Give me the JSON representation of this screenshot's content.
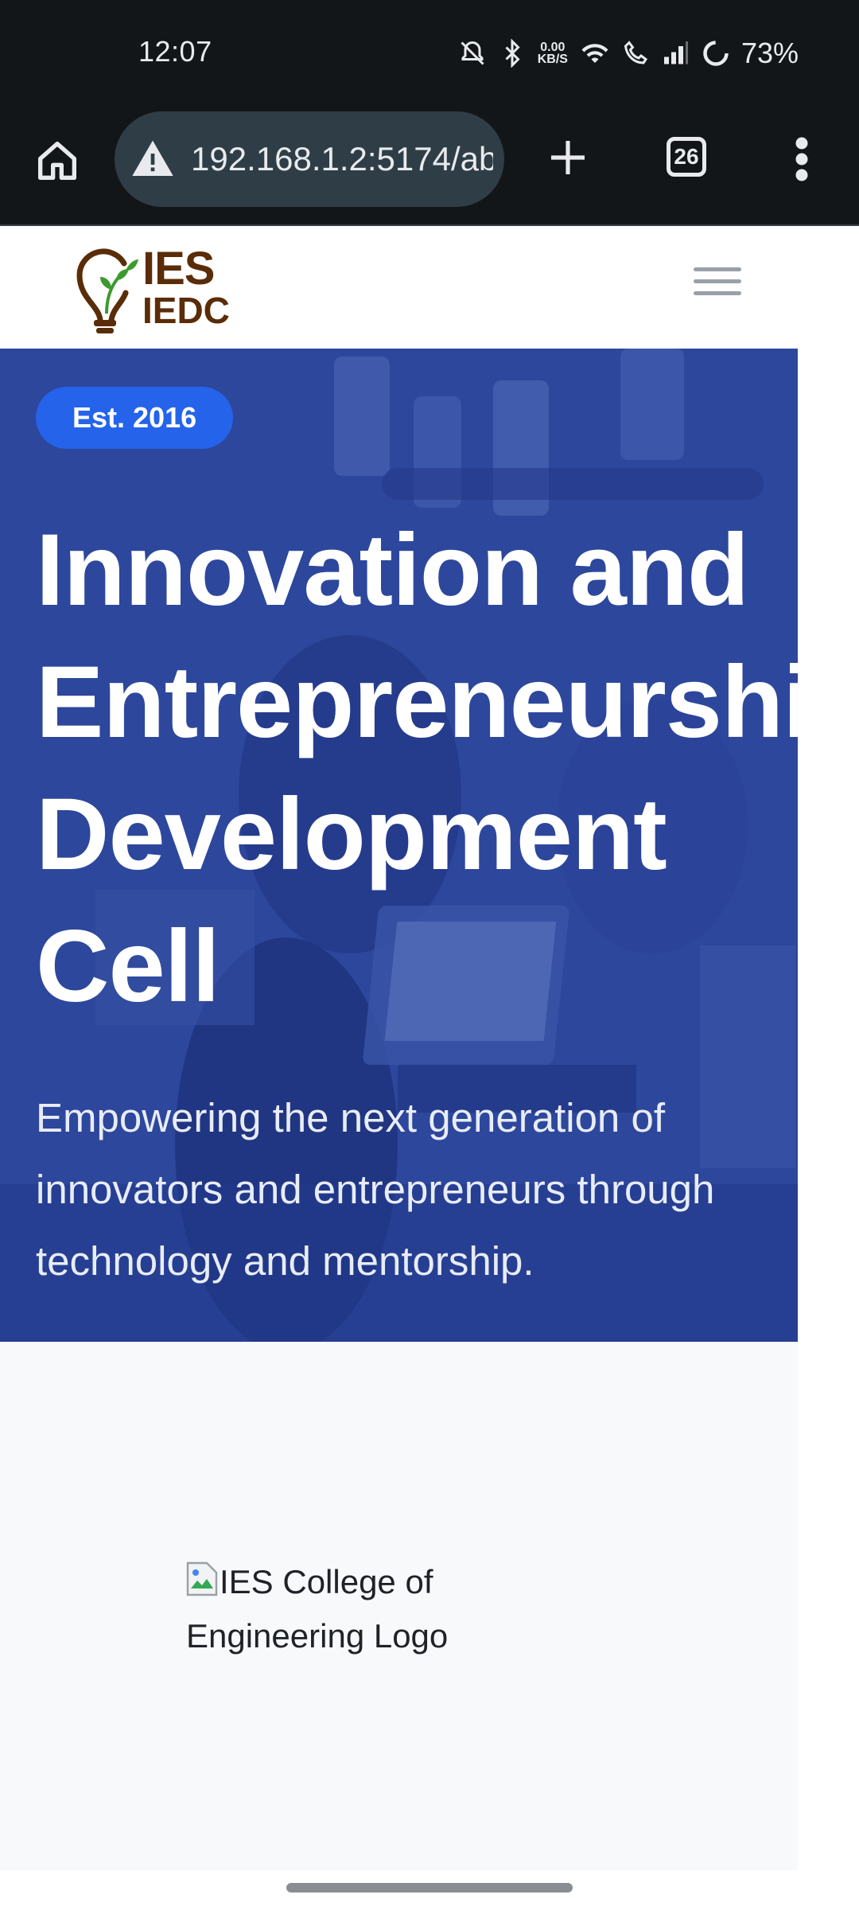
{
  "status_bar": {
    "time": "12:07",
    "net_speed_value": "0.00",
    "net_speed_unit": "KB/S",
    "battery": "73%",
    "icons": [
      "mute-icon",
      "bluetooth-icon",
      "wifi-icon",
      "wifi-calling-icon",
      "signal-icon",
      "battery-icon"
    ]
  },
  "browser": {
    "url": "192.168.1.2:5174/ab",
    "tab_count": "26",
    "icons": [
      "home-icon",
      "warning-icon",
      "plus-icon",
      "tabs-icon",
      "more-vert-icon"
    ]
  },
  "site": {
    "logo_line1": "IES",
    "logo_line2": "IEDC",
    "hero": {
      "badge": "Est. 2016",
      "title": "Innovation and\nEntrepreneurship\nDevelopment\nCell",
      "subtitle": "Empowering the next generation of innovators and entrepreneurs through technology and mentorship."
    },
    "college_logo_alt": "IES College of Engineering Logo"
  },
  "colors": {
    "hero_overlay": "#2f4ba2",
    "badge": "#2563eb",
    "logo_brown": "#5a2d08",
    "logo_green": "#3d9a2f"
  }
}
